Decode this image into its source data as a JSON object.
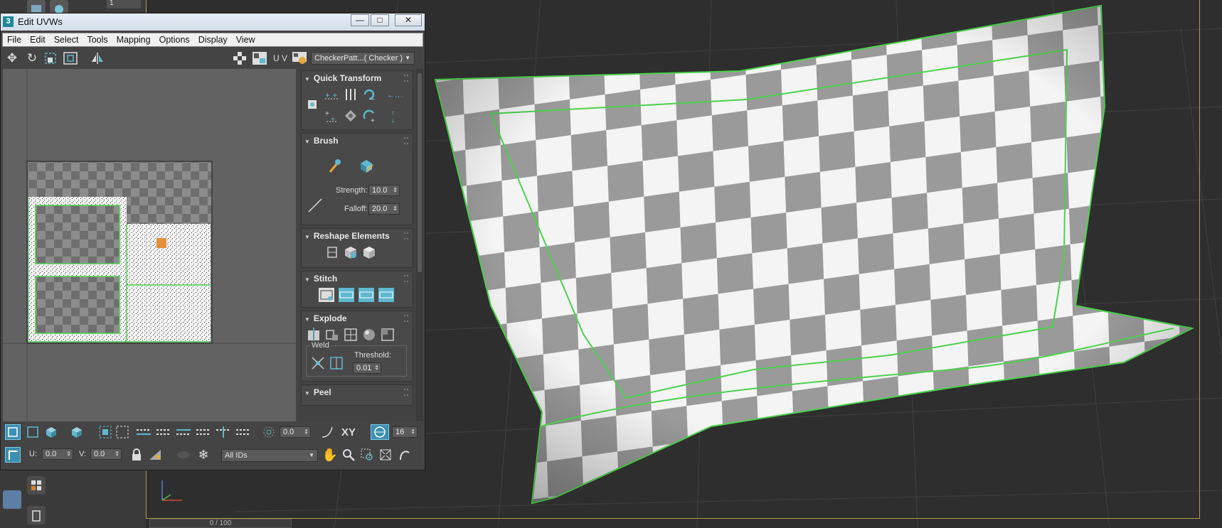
{
  "window": {
    "title": "Edit UVWs",
    "app_icon": "3",
    "minimize": "—",
    "maximize": "□",
    "close": "✕"
  },
  "menu": [
    "File",
    "Edit",
    "Select",
    "Tools",
    "Mapping",
    "Options",
    "Display",
    "View"
  ],
  "toolbar": {
    "uv_label": "U V",
    "texture_dropdown": "CheckerPatt...( Checker )"
  },
  "panel": {
    "quick_transform": "Quick Transform",
    "brush": "Brush",
    "strength_label": "Strength:",
    "strength_value": "10.0",
    "falloff_label": "Falloff:",
    "falloff_value": "20.0",
    "reshape": "Reshape Elements",
    "stitch": "Stitch",
    "explode": "Explode",
    "weld_label": "Weld",
    "threshold_label": "Threshold:",
    "threshold_value": "0.01",
    "peel": "Peel"
  },
  "bottom": {
    "rotate_value": "0.0",
    "xy_label": "XY",
    "grid_value": "16",
    "u_label": "U:",
    "u_value": "0.0",
    "v_label": "V:",
    "v_value": "0.0",
    "ids_dropdown": "All IDs"
  },
  "scene": {
    "top_field": "1",
    "timeline": "0 / 100",
    "selection_color": "#4cd14c",
    "checker_light": "#f4f4f4",
    "checker_dark": "#9a9a9a"
  }
}
